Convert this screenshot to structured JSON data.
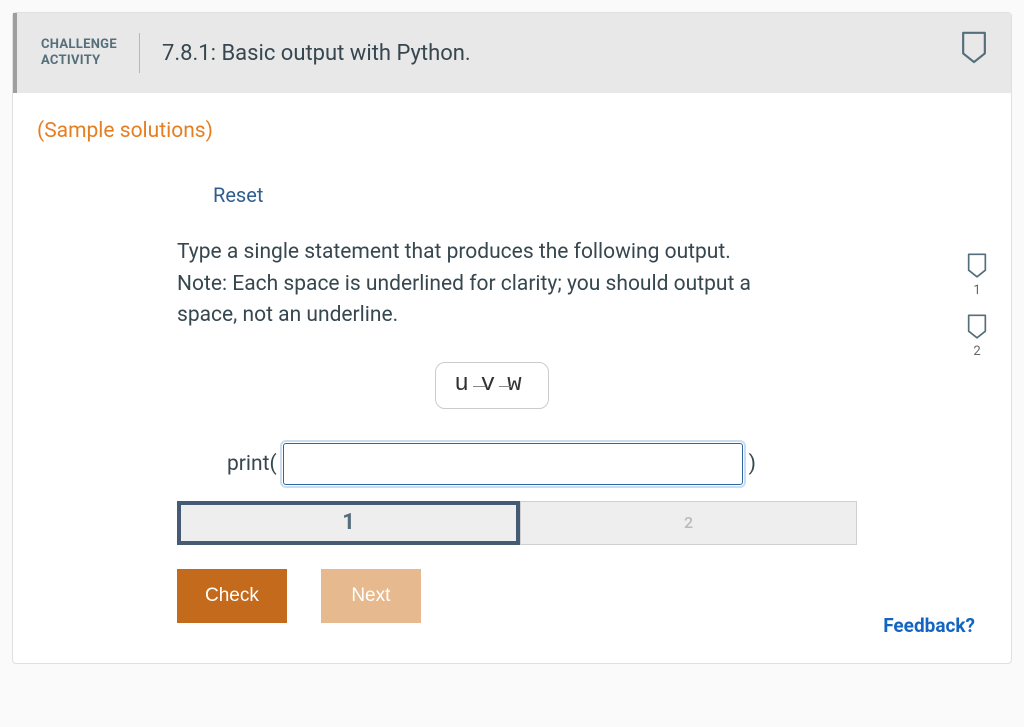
{
  "header": {
    "badge_line1": "CHALLENGE",
    "badge_line2": "ACTIVITY",
    "title": "7.8.1: Basic output with Python."
  },
  "sample_solutions_label": "(Sample solutions)",
  "reset_label": "Reset",
  "instruction_text": "Type a single statement that produces the following output.\nNote: Each space is underlined for clarity; you should output a space, not an underline.",
  "expected_output": {
    "chars": [
      "u",
      "v",
      "w"
    ]
  },
  "code_prompt": {
    "prefix": "print(",
    "input_value": "",
    "suffix": ")"
  },
  "steps": [
    {
      "label": "1",
      "active": true
    },
    {
      "label": "2",
      "active": false
    }
  ],
  "buttons": {
    "check": "Check",
    "next": "Next"
  },
  "side_markers": [
    "1",
    "2"
  ],
  "feedback_label": "Feedback?"
}
